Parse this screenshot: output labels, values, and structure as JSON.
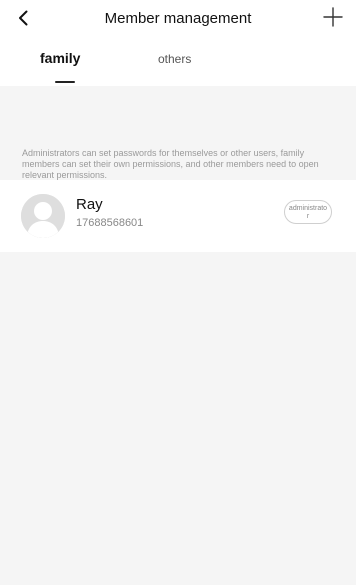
{
  "header": {
    "title": "Member management",
    "back_icon": "chevron-left-icon",
    "add_icon": "plus-icon"
  },
  "tabs": [
    {
      "label": "family",
      "active": true
    },
    {
      "label": "others",
      "active": false
    }
  ],
  "notice": "Administrators can set passwords for themselves or other users, family members can set their own permissions, and other members need to open relevant permissions.",
  "members": [
    {
      "name": "Ray",
      "phone": "17688568601",
      "role": "administrator",
      "avatar_icon": "user-avatar-icon"
    }
  ],
  "colors": {
    "background": "#f5f5f5",
    "surface": "#ffffff",
    "text": "#111111",
    "muted": "#9a9a9a"
  }
}
